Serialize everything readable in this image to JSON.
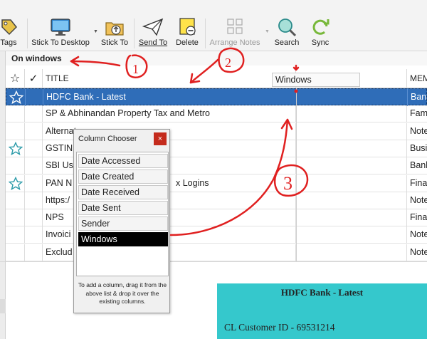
{
  "toolbar": {
    "items": [
      {
        "label": "Tags",
        "icon": "tag-icon",
        "enabled": true
      },
      {
        "label": "Stick To Desktop",
        "icon": "monitor-icon",
        "enabled": true
      },
      {
        "label": "Stick To",
        "icon": "folder-up-icon",
        "enabled": true
      },
      {
        "label": "Send To",
        "icon": "paper-plane-icon",
        "enabled": true
      },
      {
        "label": "Delete",
        "icon": "delete-note-icon",
        "enabled": true
      },
      {
        "label": "Arrange Notes",
        "icon": "grid-icon",
        "enabled": false
      },
      {
        "label": "Search",
        "icon": "magnifier-icon",
        "enabled": true
      },
      {
        "label": "Sync",
        "icon": "sync-icon",
        "enabled": true
      }
    ]
  },
  "group": {
    "title": "On windows"
  },
  "grid": {
    "headers": {
      "star": "☆",
      "check": "✓",
      "title": "TITLE",
      "windows": "Windows",
      "mem": "MEM"
    },
    "rows": [
      {
        "starred": true,
        "title": "HDFC Bank - Latest",
        "mem": "Bank",
        "selected": true
      },
      {
        "starred": false,
        "title": "SP & Abhinandan Property Tax and Metro",
        "mem": "Famil",
        "selected": false
      },
      {
        "starred": false,
        "title": "Alternat",
        "mem": "Note",
        "selected": false
      },
      {
        "starred": true,
        "title": "GSTIN",
        "mem": "Busin",
        "selected": false
      },
      {
        "starred": false,
        "title": "SBI Use",
        "mem": "Bank",
        "selected": false
      },
      {
        "starred": true,
        "title": "PAN N",
        "title_tail": "x Logins",
        "mem": "Finan",
        "selected": false
      },
      {
        "starred": false,
        "title": "https:/",
        "mem": "Note",
        "selected": false
      },
      {
        "starred": false,
        "title": "NPS",
        "mem": "Finan",
        "selected": false
      },
      {
        "starred": false,
        "title": "Invoici",
        "mem": "Note",
        "selected": false
      },
      {
        "starred": false,
        "title": "Exclud",
        "mem": "Note",
        "selected": false
      }
    ]
  },
  "chooser": {
    "title": "Column Chooser",
    "close": "×",
    "items": [
      "Date Accessed",
      "Date Created",
      "Date Received",
      "Date Sent",
      "Sender",
      "Windows"
    ],
    "active_item": "Windows",
    "note": "To add a column, drag it from the above list & drop it over the existing columns."
  },
  "preview": {
    "title": "HDFC Bank - Latest",
    "line1": "CL Customer ID - 69531214"
  },
  "annotations": {
    "labels": [
      "1",
      "2",
      "3"
    ],
    "color": "#e02020"
  },
  "colors": {
    "selection": "#2f6db8",
    "preview_bg": "#35c8cc",
    "star_outline": "#2a9aa8"
  }
}
